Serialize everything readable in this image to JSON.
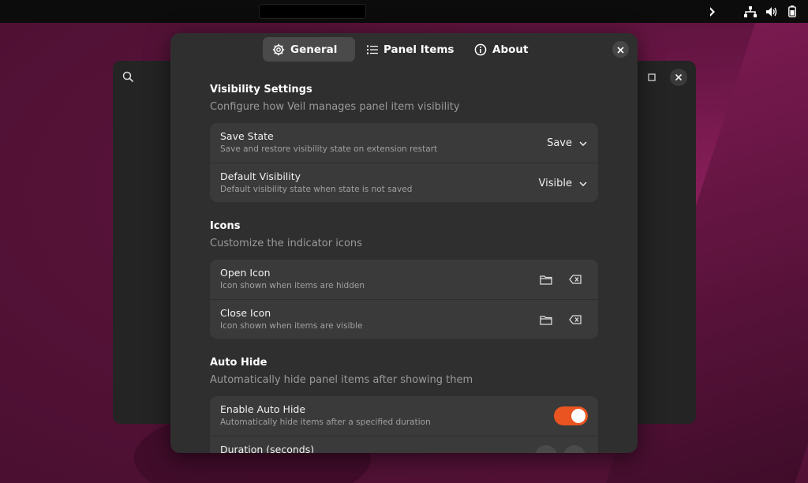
{
  "tabs": [
    {
      "label": "General",
      "icon": "gear-icon",
      "active": true
    },
    {
      "label": "Panel Items",
      "icon": "list-icon",
      "active": false
    },
    {
      "label": "About",
      "icon": "info-icon",
      "active": false
    }
  ],
  "sections": {
    "visibility": {
      "title": "Visibility Settings",
      "subtitle": "Configure how Veil manages panel item visibility",
      "rows": [
        {
          "title": "Save State",
          "subtitle": "Save and restore visibility state on extension restart",
          "value": "Save"
        },
        {
          "title": "Default Visibility",
          "subtitle": "Default visibility state when state is not saved",
          "value": "Visible"
        }
      ]
    },
    "icons": {
      "title": "Icons",
      "subtitle": "Customize the indicator icons",
      "rows": [
        {
          "title": "Open Icon",
          "subtitle": "Icon shown when items are hidden"
        },
        {
          "title": "Close Icon",
          "subtitle": "Icon shown when items are visible"
        }
      ]
    },
    "autohide": {
      "title": "Auto Hide",
      "subtitle": "Automatically hide panel items after showing them",
      "rows": [
        {
          "title": "Enable Auto Hide",
          "subtitle": "Automatically hide items after a specified duration",
          "enabled": true
        },
        {
          "title": "Duration (seconds)"
        }
      ]
    }
  },
  "colors": {
    "accent": "#e95420",
    "dialog_bg": "#2f2f2f",
    "card_bg": "#3a3a3a"
  }
}
